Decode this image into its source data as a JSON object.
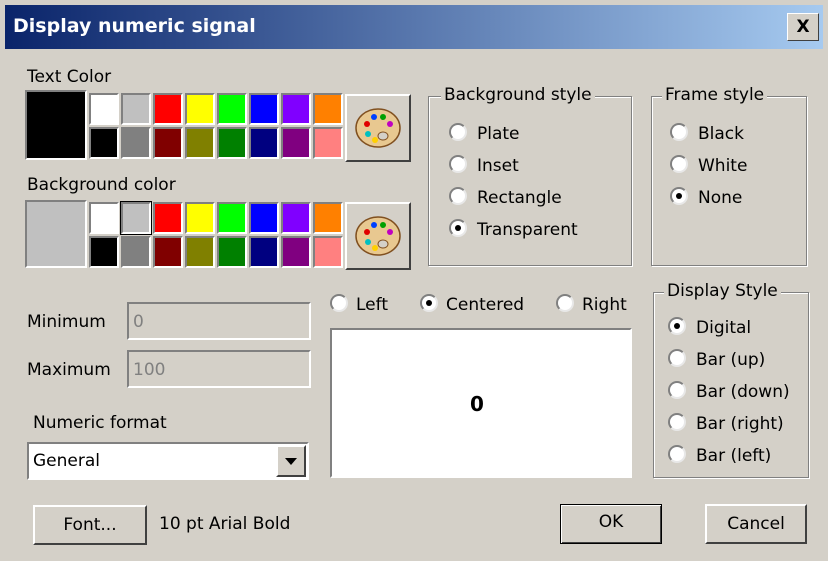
{
  "window": {
    "title": "Display numeric signal",
    "close_label": "X"
  },
  "text_color": {
    "label": "Text Color",
    "selected": "#000000",
    "swatches_top": [
      "#ffffff",
      "#c0c0c0",
      "#ff0000",
      "#ffff00",
      "#00ff00",
      "#0000ff",
      "#8000ff",
      "#ff8000"
    ],
    "swatches_bottom": [
      "#000000",
      "#808080",
      "#800000",
      "#808000",
      "#008000",
      "#000080",
      "#800080",
      "#ff8080"
    ]
  },
  "background_color": {
    "label": "Background color",
    "selected": "#c0c0c0",
    "swatches_top": [
      "#ffffff",
      "#c0c0c0",
      "#ff0000",
      "#ffff00",
      "#00ff00",
      "#0000ff",
      "#8000ff",
      "#ff8000"
    ],
    "swatches_bottom": [
      "#000000",
      "#808080",
      "#800000",
      "#808000",
      "#008000",
      "#000080",
      "#800080",
      "#ff8080"
    ]
  },
  "background_style": {
    "label": "Background style",
    "options": [
      "Plate",
      "Inset",
      "Rectangle",
      "Transparent"
    ],
    "selected": "Transparent"
  },
  "frame_style": {
    "label": "Frame style",
    "options": [
      "Black",
      "White",
      "None"
    ],
    "selected": "None"
  },
  "alignment": {
    "options": [
      "Left",
      "Centered",
      "Right"
    ],
    "selected": "Centered"
  },
  "preview_value": "0",
  "minimum": {
    "label": "Minimum",
    "value": "0"
  },
  "maximum": {
    "label": "Maximum",
    "value": "100"
  },
  "numeric_format": {
    "label": "Numeric format",
    "value": "General"
  },
  "display_style": {
    "label": "Display Style",
    "options": [
      "Digital",
      "Bar (up)",
      "Bar (down)",
      "Bar (right)",
      "Bar (left)"
    ],
    "selected": "Digital"
  },
  "font": {
    "button_label": "Font...",
    "description": "10 pt Arial Bold"
  },
  "ok_label": "OK",
  "cancel_label": "Cancel",
  "icons": {
    "palette": "palette-icon",
    "dropdown": "chevron-down-icon"
  }
}
